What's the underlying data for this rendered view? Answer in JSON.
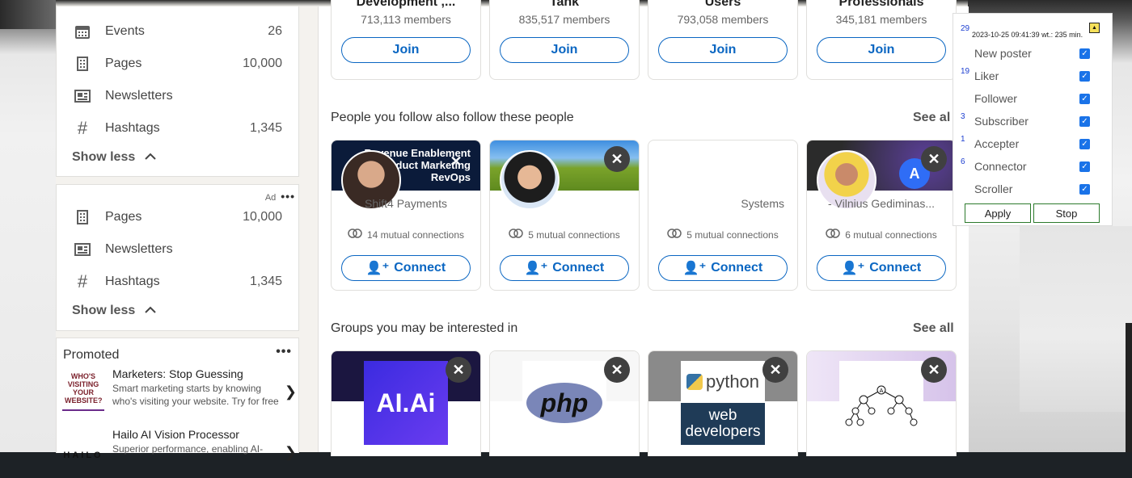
{
  "left": {
    "nav_top": [
      {
        "label": "Events",
        "count": "26",
        "icon": "calendar-icon"
      },
      {
        "label": "Pages",
        "count": "10,000",
        "icon": "building-icon"
      },
      {
        "label": "Newsletters",
        "count": "",
        "icon": "newspaper-icon"
      },
      {
        "label": "Hashtags",
        "count": "1,345",
        "icon": "hashtag-icon"
      }
    ],
    "show_less_1": "Show less",
    "ad_label": "Ad",
    "nav_bottom": [
      {
        "label": "Pages",
        "count": "10,000",
        "icon": "building-icon"
      },
      {
        "label": "Newsletters",
        "count": "",
        "icon": "newspaper-icon"
      },
      {
        "label": "Hashtags",
        "count": "1,345",
        "icon": "hashtag-icon"
      }
    ],
    "show_less_2": "Show less",
    "promoted": {
      "title": "Promoted",
      "items": [
        {
          "title": "Marketers: Stop Guessing",
          "desc": "Smart marketing starts by knowing who's visiting your website. Try for free",
          "logo_text": "WHO'S VISITING YOUR WEBSITE?"
        },
        {
          "title": "Hailo AI Vision Processor",
          "desc": "Superior performance, enabling AI-",
          "logo_text": "HAILO"
        }
      ]
    }
  },
  "groups_top": [
    {
      "name": "Development ,...",
      "members": "713,113 members",
      "action": "Join"
    },
    {
      "name": "Tank",
      "members": "835,517 members",
      "action": "Join"
    },
    {
      "name": "Users",
      "members": "793,058 members",
      "action": "Join"
    },
    {
      "name": "Professionals",
      "members": "345,181 members",
      "action": "Join"
    }
  ],
  "people_section": {
    "title": "People you follow also follow these people",
    "see_all": "See al",
    "cards": [
      {
        "desc": "Shift4 Payments",
        "mutual": "14 mutual connections",
        "action": "Connect",
        "banner_lines": [
          "Revenue Enablement",
          "Product Marketing",
          "RevOps"
        ]
      },
      {
        "desc": "",
        "mutual": "5 mutual connections",
        "action": "Connect"
      },
      {
        "desc": "Systems",
        "mutual": "5 mutual connections",
        "action": "Connect"
      },
      {
        "desc": "- Vilnius Gediminas...",
        "mutual": "6 mutual connections",
        "action": "Connect"
      }
    ]
  },
  "groups_section": {
    "title": "Groups you may be interested in",
    "see_all": "See all",
    "cards": [
      {
        "logo_text": "AI.Ai"
      },
      {
        "logo_text": "php"
      },
      {
        "logo_text": "python",
        "logo_sub": "web developers"
      },
      {
        "logo_text": "A"
      }
    ]
  },
  "panel": {
    "num_top": "29",
    "timestamp": "2023-10-25 09:41:39 wt.: 235 min.",
    "side_nums": [
      "19",
      "3",
      "1",
      "6"
    ],
    "options": [
      {
        "label": "New poster",
        "checked": true
      },
      {
        "label": "Liker",
        "checked": true
      },
      {
        "label": "Follower",
        "checked": true
      },
      {
        "label": "Subscriber",
        "checked": true
      },
      {
        "label": "Accepter",
        "checked": true
      },
      {
        "label": "Connector",
        "checked": true
      },
      {
        "label": "Scroller",
        "checked": true
      }
    ],
    "apply": "Apply",
    "stop": "Stop"
  }
}
